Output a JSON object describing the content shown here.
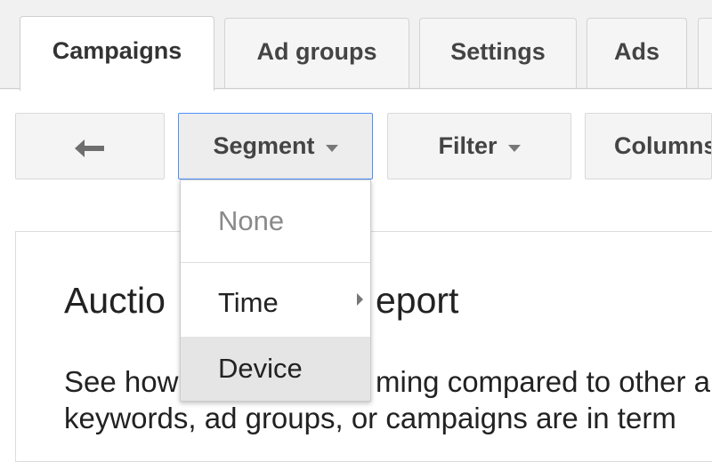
{
  "tabs": [
    {
      "label": "Campaigns",
      "active": true
    },
    {
      "label": "Ad groups",
      "active": false
    },
    {
      "label": "Settings",
      "active": false
    },
    {
      "label": "Ads",
      "active": false
    }
  ],
  "toolbar": {
    "back_icon": "back-arrow-icon",
    "segment_label": "Segment",
    "filter_label": "Filter",
    "columns_label": "Columns"
  },
  "segment_menu": {
    "items": [
      {
        "label": "None",
        "disabled": true
      },
      {
        "label": "Time",
        "has_submenu": true
      },
      {
        "label": "Device",
        "highlighted": true
      }
    ]
  },
  "content": {
    "title_left": "Auctio",
    "title_right": "eport",
    "line1_left": "See how",
    "line1_right": "ming compared to other a",
    "line2": "keywords, ad groups, or campaigns are in term"
  },
  "colors": {
    "focus_border": "#4d90fe",
    "menu_hover": "#e5e5e5"
  }
}
